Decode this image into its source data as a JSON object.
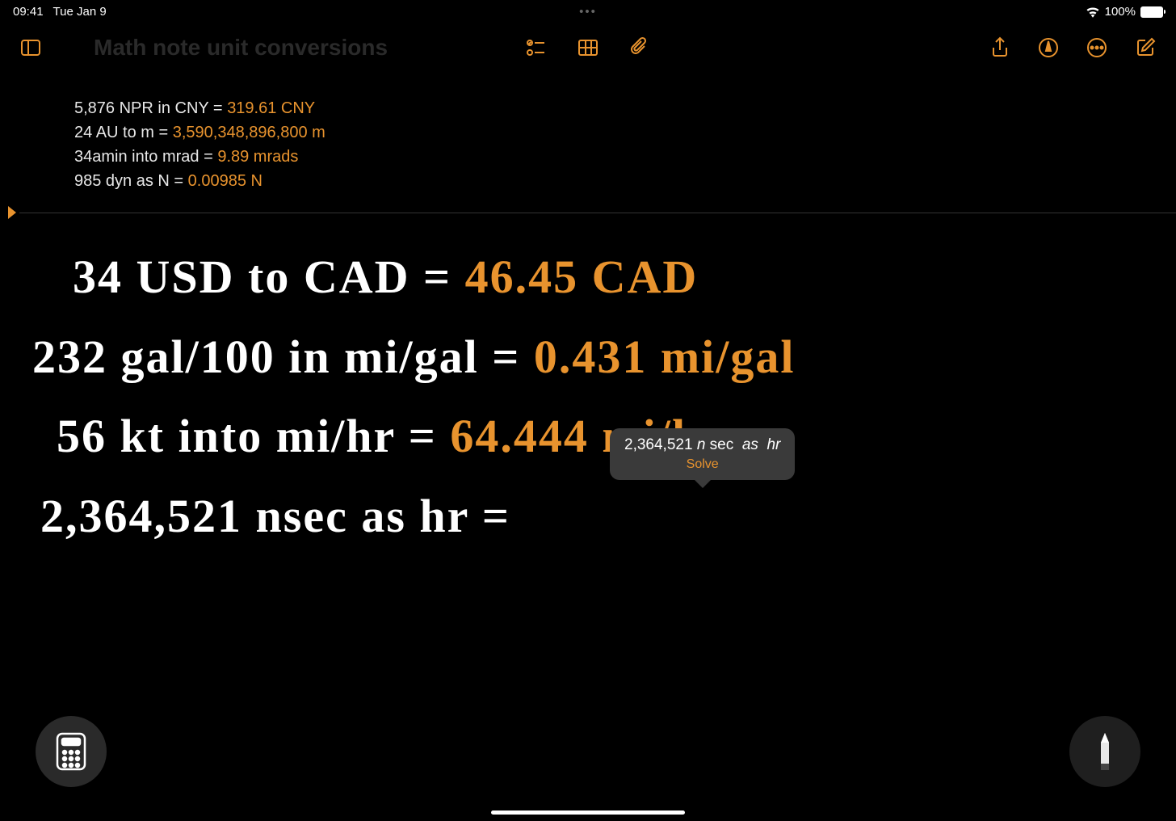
{
  "status": {
    "time": "09:41",
    "date": "Tue Jan 9",
    "dots": "•••",
    "battery": "100%"
  },
  "title": "Math note unit conversions",
  "typed": [
    {
      "expr": "5,876 NPR in CNY =",
      "result": "319.61 CNY"
    },
    {
      "expr": "24 AU to m =",
      "result": "3,590,348,896,800 m"
    },
    {
      "expr": "34amin into mrad =",
      "result": "9.89 mrads"
    },
    {
      "expr": "985 dyn as N =",
      "result": "0.00985 N"
    }
  ],
  "handwritten": [
    {
      "expr": "34 USD to CAD =",
      "result": "46.45 CAD"
    },
    {
      "expr": "232 gal/100 in mi/gal =",
      "result": "0.431 mi/gal"
    },
    {
      "expr": "56 kt into mi/hr =",
      "result": "64.444 mi/hr"
    },
    {
      "expr": "2,364,521 nsec as hr =",
      "result": ""
    }
  ],
  "tooltip": {
    "num": "2,364,521",
    "unit1": "n",
    "mid": "sec",
    "as": "as",
    "unit2": "hr",
    "action": "Solve"
  },
  "icons": {
    "sidebar": "sidebar",
    "checklist": "checklist",
    "table": "table",
    "attach": "attach",
    "share": "share",
    "markup": "markup",
    "more": "more",
    "compose": "compose"
  }
}
